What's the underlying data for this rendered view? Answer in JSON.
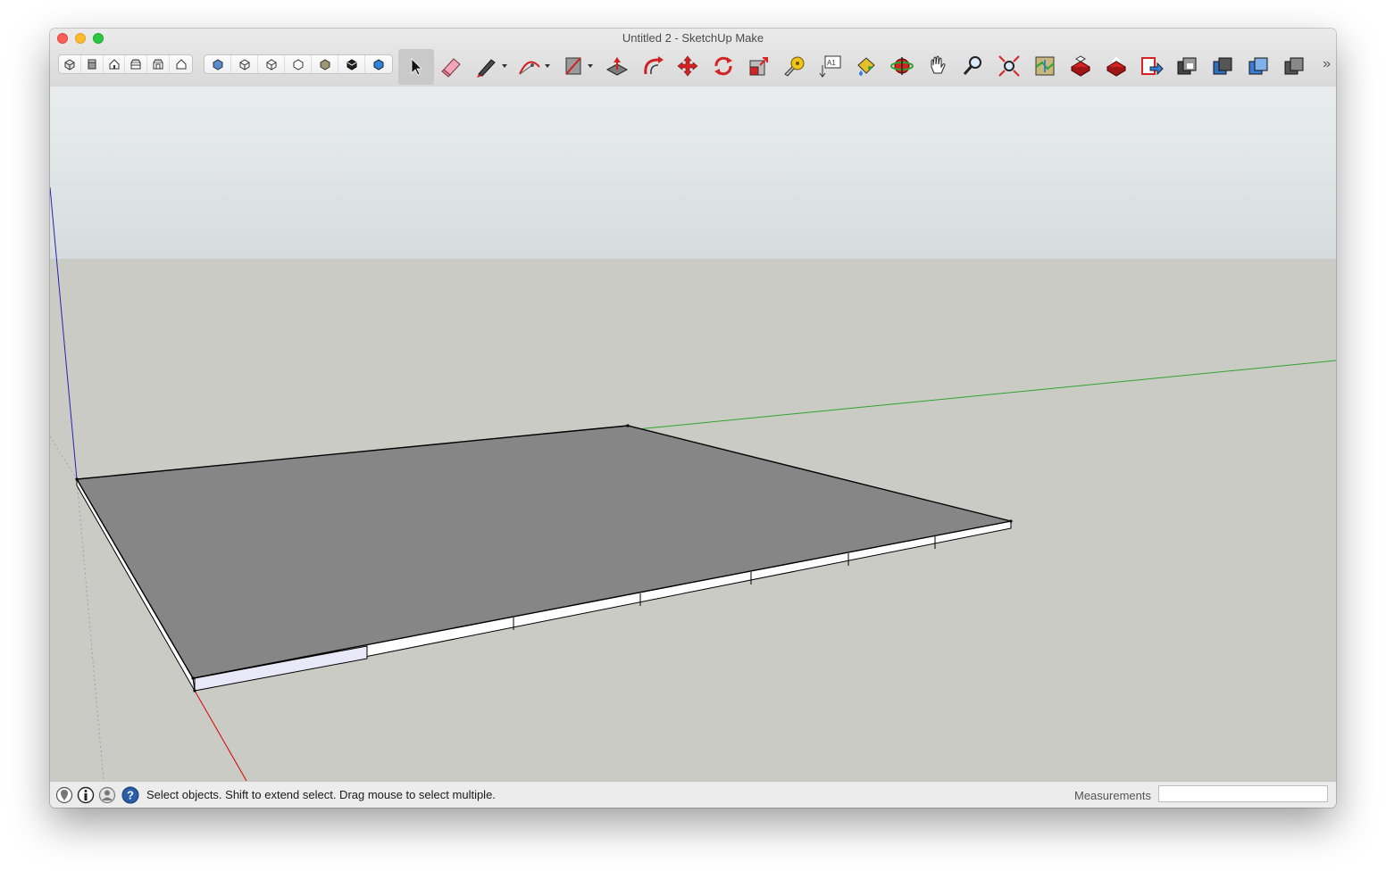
{
  "window": {
    "title": "Untitled 2 - SketchUp Make"
  },
  "toolbar": {
    "views_group": [
      "iso-view-icon",
      "top-view-icon",
      "front-view-icon",
      "right-view-icon",
      "back-view-icon",
      "left-view-icon"
    ],
    "styles_group": [
      "xray-style-icon",
      "wireframe-style-icon",
      "hidden-line-style-icon",
      "shaded-style-icon",
      "shaded-textures-style-icon",
      "monochrome-style-icon",
      "back-edges-style-icon"
    ],
    "tools": [
      "select-arrow-icon",
      "eraser-icon",
      "pencil-icon",
      "arc-icon",
      "rectangle-icon",
      "push-pull-icon",
      "follow-me-icon",
      "move-icon",
      "rotate-icon",
      "scale-icon",
      "tape-measure-icon",
      "text-icon",
      "paint-bucket-icon",
      "orbit-icon",
      "pan-icon",
      "zoom-icon",
      "zoom-extents-icon",
      "add-location-icon",
      "3d-warehouse-icon",
      "extension-warehouse-icon",
      "send-to-layout-icon",
      "outliner-icon",
      "components-icon",
      "materials-icon",
      "layers-icon"
    ],
    "overflow": "»"
  },
  "statusbar": {
    "icons": [
      "geo-location-icon",
      "credits-icon",
      "user-account-icon",
      "help-icon"
    ],
    "help_glyph": "?",
    "message": "Select objects. Shift to extend select. Drag mouse to select multiple.",
    "measurements_label": "Measurements",
    "measurements_value": ""
  },
  "colors": {
    "sky_top": "#e8eced",
    "sky_bottom": "#d5dbdd",
    "ground": "#cbcbc6",
    "face_top": "#868686",
    "face_side": "#ffffff",
    "selected_side": "#e9e8f9",
    "edge": "#000000",
    "axis_red": "#d40000",
    "axis_green": "#2ea42e",
    "axis_blue": "#2323b9"
  }
}
